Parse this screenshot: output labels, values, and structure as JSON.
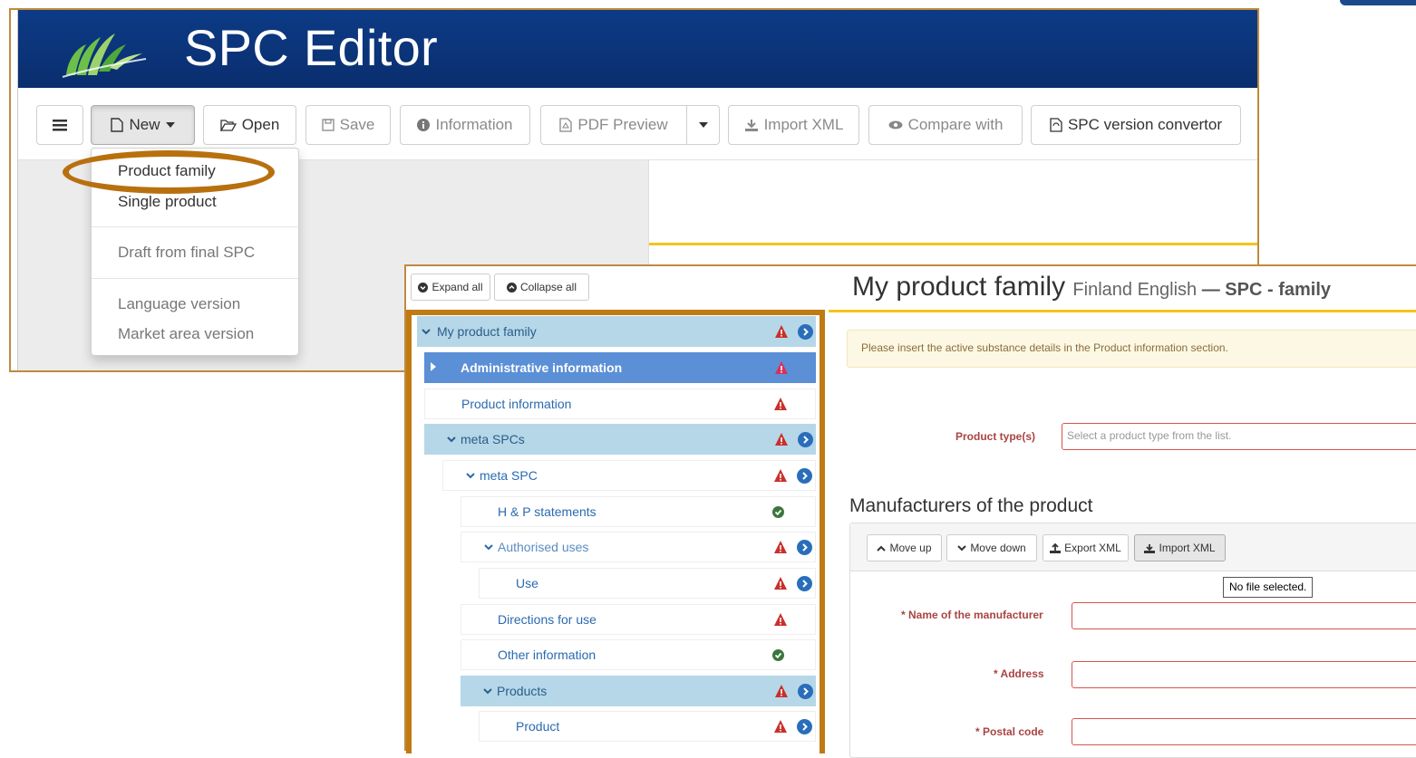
{
  "app": {
    "title": "SPC Editor"
  },
  "toolbar": {
    "new_label": "New",
    "open_label": "Open",
    "save_label": "Save",
    "information_label": "Information",
    "pdf_preview_label": "PDF Preview",
    "import_xml_label": "Import XML",
    "compare_with_label": "Compare with",
    "spc_version_convertor_label": "SPC version convertor"
  },
  "new_menu": {
    "items": [
      {
        "label": "Product family"
      },
      {
        "label": "Single product"
      },
      {
        "label": "Draft from final SPC"
      },
      {
        "label": "Language version"
      },
      {
        "label": "Market area version"
      }
    ]
  },
  "tree": {
    "expand_all_label": "Expand all",
    "collapse_all_label": "Collapse all",
    "nodes": [
      {
        "label": "My product family",
        "status": "warning"
      },
      {
        "label": "Administrative information",
        "status": "warning"
      },
      {
        "label": "Product information",
        "status": "warning"
      },
      {
        "label": "meta SPCs",
        "status": "warning"
      },
      {
        "label": "meta SPC",
        "status": "warning"
      },
      {
        "label": "H & P statements",
        "status": "ok"
      },
      {
        "label": "Authorised uses",
        "status": "warning"
      },
      {
        "label": "Use",
        "status": "warning"
      },
      {
        "label": "Directions for use",
        "status": "warning"
      },
      {
        "label": "Other information",
        "status": "ok"
      },
      {
        "label": "Products",
        "status": "warning"
      },
      {
        "label": "Product",
        "status": "warning"
      }
    ]
  },
  "main": {
    "title": "My product family",
    "subtitle_locale": "Finland English",
    "subtitle_sep": "—",
    "subtitle_type": "SPC - family",
    "warning_message": "Please insert the active substance details in the Product information section.",
    "product_types_label": "Product type(s)",
    "product_types_placeholder": "Select a product type from the list.",
    "manufacturers_title": "Manufacturers of the product",
    "move_up_label": "Move up",
    "move_down_label": "Move down",
    "export_xml_label": "Export XML",
    "import_xml_label": "Import XML",
    "file_tooltip": "No file selected.",
    "name_label": "* Name of the manufacturer",
    "address_label": "* Address",
    "postal_code_label": "* Postal code"
  },
  "colors": {
    "banner": "#0d3b86",
    "highlight_ring": "#b8700f",
    "warning_icon": "#c9302c",
    "ok_icon": "#3c763d",
    "go_icon": "#2a6ebb",
    "selected_node": "#5b8fd6",
    "tree_highlight": "#b6d7e8",
    "required_label": "#a94442"
  }
}
